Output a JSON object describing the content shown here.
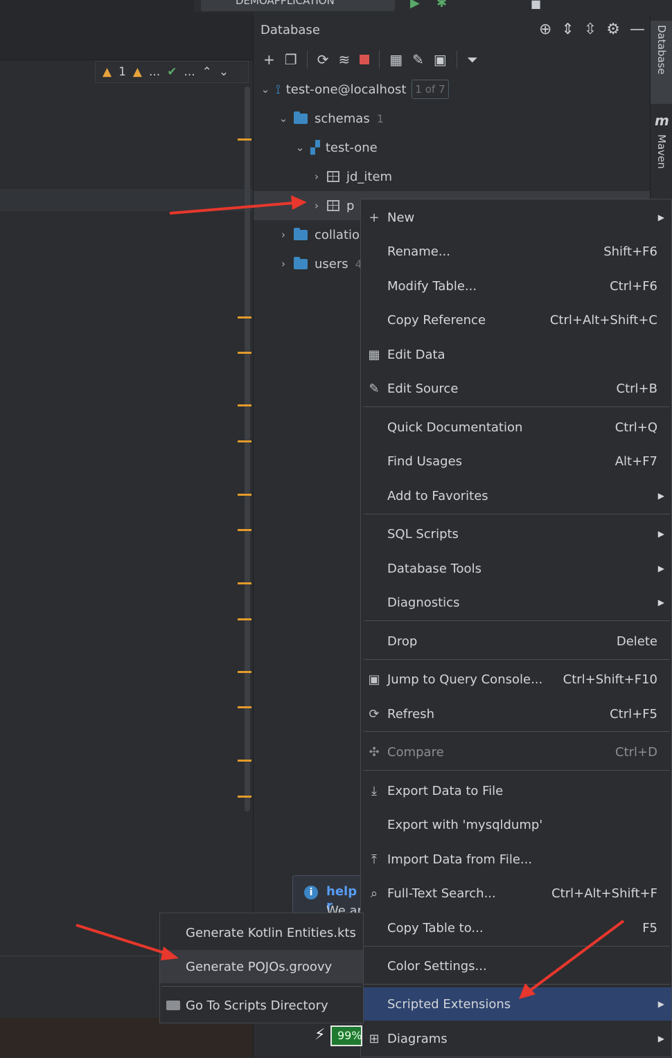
{
  "toolbar_top": {
    "run_config": "DEMOAPPLICATION"
  },
  "editor": {
    "inspections": {
      "warnings_count": "1",
      "weak_warnings": "...",
      "typos": "..."
    }
  },
  "database_panel": {
    "title": "Database",
    "tree": [
      {
        "label": "test-one@localhost",
        "badge": "1 of 7"
      },
      {
        "label": "schemas",
        "count": "1"
      },
      {
        "label": "test-one"
      },
      {
        "label": "jd_item"
      },
      {
        "label": "p"
      },
      {
        "label": "collatio"
      },
      {
        "label": "users",
        "count": "4"
      }
    ]
  },
  "side_tabs": {
    "database": "Database",
    "maven": "Maven",
    "maven_icon": "m"
  },
  "context_menu": {
    "items": [
      {
        "label": "New",
        "shortcut": "",
        "submenu": true,
        "icon": "plus-icon"
      },
      {
        "label": "Rename...",
        "shortcut": "Shift+F6"
      },
      {
        "label": "Modify Table...",
        "shortcut": "Ctrl+F6"
      },
      {
        "label": "Copy Reference",
        "shortcut": "Ctrl+Alt+Shift+C"
      },
      {
        "label": "Edit Data",
        "shortcut": "",
        "icon": "table-icon"
      },
      {
        "label": "Edit Source",
        "shortcut": "Ctrl+B",
        "icon": "pencil-icon"
      },
      {
        "label": "Quick Documentation",
        "shortcut": "Ctrl+Q"
      },
      {
        "label": "Find Usages",
        "shortcut": "Alt+F7"
      },
      {
        "label": "Add to Favorites",
        "submenu": true
      },
      {
        "label": "SQL Scripts",
        "submenu": true
      },
      {
        "label": "Database Tools",
        "submenu": true
      },
      {
        "label": "Diagnostics",
        "submenu": true
      },
      {
        "label": "Drop",
        "shortcut": "Delete"
      },
      {
        "label": "Jump to Query Console...",
        "shortcut": "Ctrl+Shift+F10",
        "icon": "query-console-icon"
      },
      {
        "label": "Refresh",
        "shortcut": "Ctrl+F5",
        "icon": "refresh-icon"
      },
      {
        "label": "Compare",
        "shortcut": "Ctrl+D",
        "icon": "compare-icon",
        "disabled": true
      },
      {
        "label": "Export Data to File",
        "icon": "export-icon"
      },
      {
        "label": "Export with 'mysqldump'"
      },
      {
        "label": "Import Data from File...",
        "icon": "import-icon"
      },
      {
        "label": "Full-Text Search...",
        "shortcut": "Ctrl+Alt+Shift+F",
        "icon": "search-icon"
      },
      {
        "label": "Copy Table to...",
        "shortcut": "F5"
      },
      {
        "label": "Color Settings..."
      },
      {
        "label": "Scripted Extensions",
        "submenu": true
      },
      {
        "label": "Diagrams",
        "submenu": true,
        "icon": "diagram-icon"
      }
    ]
  },
  "submenu": {
    "items": [
      {
        "label": "Generate Kotlin Entities.kts"
      },
      {
        "label": "Generate POJOs.groovy"
      },
      {
        "label": "Go To Scripts Directory",
        "icon": "folder-icon"
      }
    ]
  },
  "notification": {
    "title": "help r",
    "body": "We ar"
  },
  "battery": {
    "level": "99%"
  },
  "colors": {
    "accent_arrow": "#e8372c",
    "highlight": "#2e436e",
    "warning": "#e39b2a"
  }
}
